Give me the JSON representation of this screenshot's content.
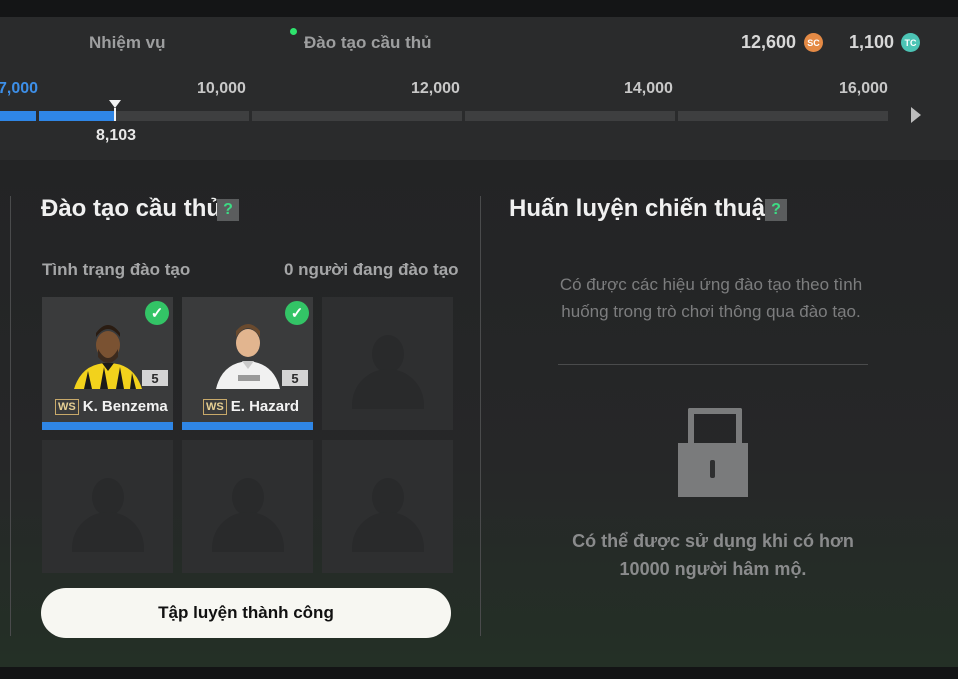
{
  "nav": {
    "tabs": [
      {
        "label": "Nhiệm vụ"
      },
      {
        "label": "Đào tạo cầu thủ",
        "active": true
      }
    ],
    "currencies": [
      {
        "value": "12,600",
        "icon": "SC"
      },
      {
        "value": "1,100",
        "icon": "TC"
      }
    ]
  },
  "progress": {
    "ticks": [
      "7,000",
      "10,000",
      "12,000",
      "14,000",
      "16,000"
    ],
    "current_label": "8,103",
    "current_value": 8103,
    "active_color": "#2f86e6"
  },
  "player_training": {
    "title": "Đào tạo cầu thủ",
    "help": "?",
    "status_label": "Tình trạng đào tạo",
    "count_label": "0 người đang đào tạo",
    "players": [
      {
        "name": "K. Benzema",
        "badge": "WS",
        "ovr": "5",
        "check": "✓"
      },
      {
        "name": "E. Hazard",
        "badge": "WS",
        "ovr": "5",
        "check": "✓"
      }
    ],
    "cta_label": "Tập luyện thành công"
  },
  "tactical": {
    "title": "Huấn luyện chiến thuật",
    "help": "?",
    "description": "Có được các hiệu ứng đào tạo theo tình huống trong trò chơi thông qua đào tạo.",
    "unlock_line1": "Có thể được sử dụng khi có hơn",
    "unlock_line2": "10000 người hâm mộ.",
    "icon": "lock-icon"
  }
}
